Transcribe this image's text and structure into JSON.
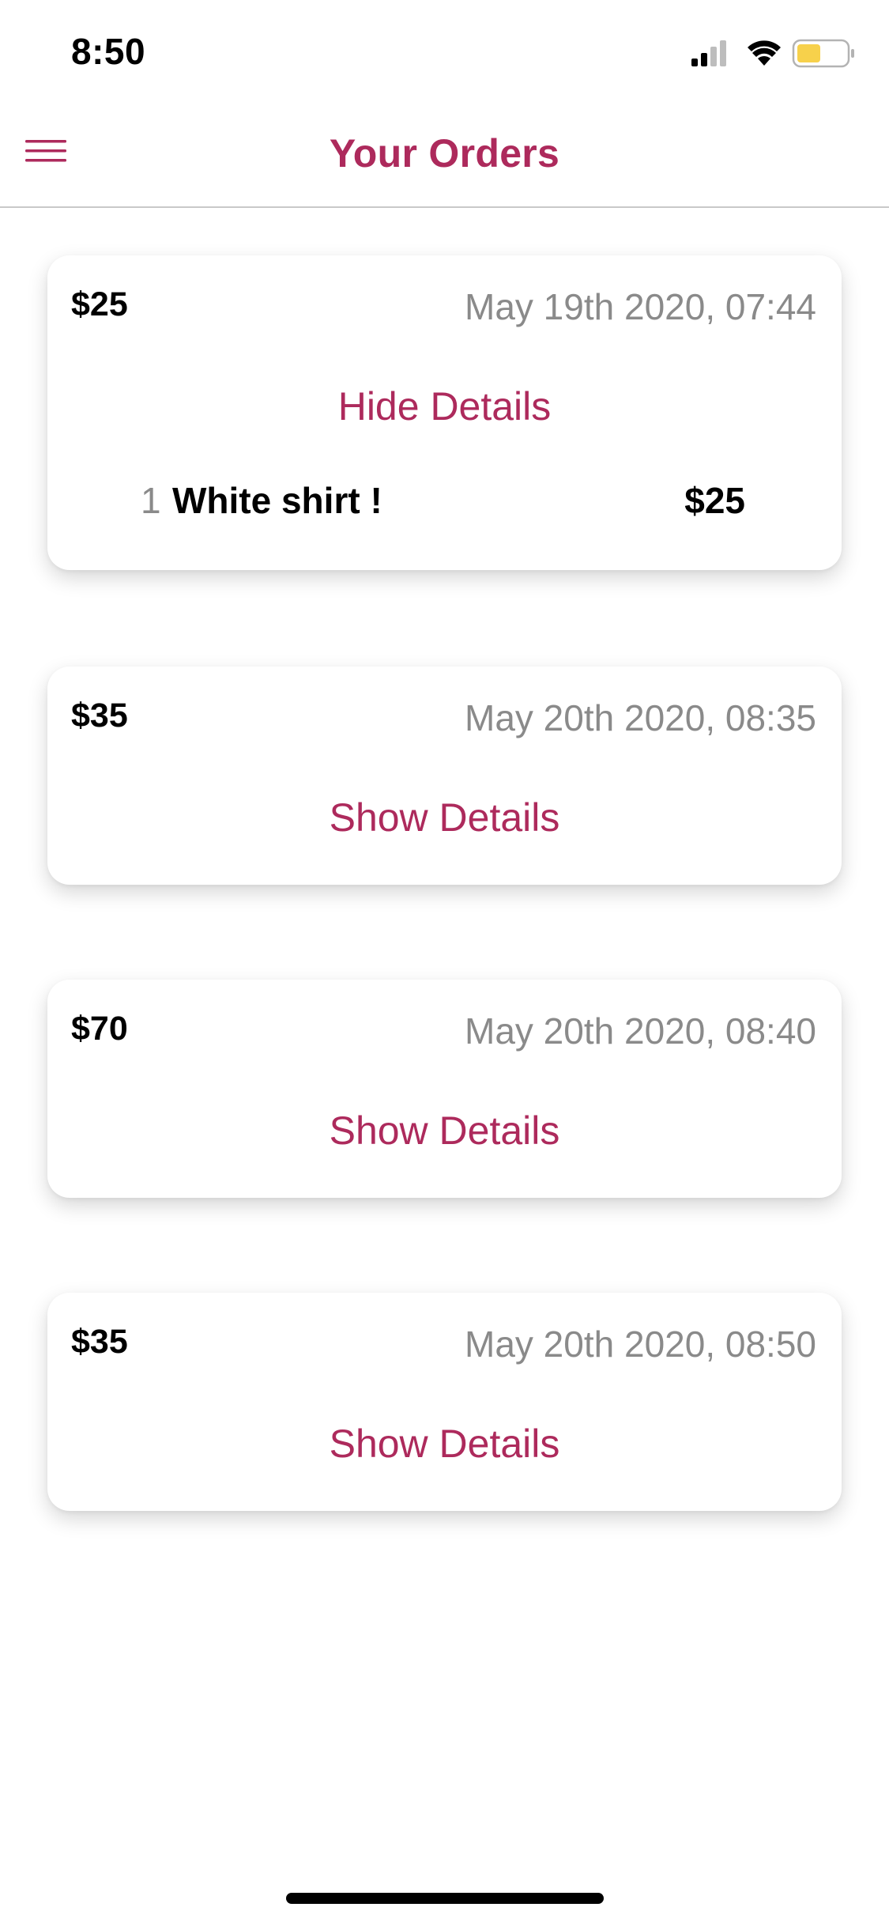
{
  "status_bar": {
    "time": "8:50",
    "icons": [
      "cellular-signal-icon",
      "wifi-icon",
      "battery-icon"
    ]
  },
  "header": {
    "title": "Your Orders",
    "menu_icon": "hamburger-menu-icon"
  },
  "colors": {
    "accent": "#ad2a5c",
    "muted_text": "#8a8a8a",
    "battery_fill": "#f7d14b"
  },
  "orders": [
    {
      "total": "$25",
      "date": "May 19th 2020, 07:44",
      "toggle_label": "Hide Details",
      "expanded": true,
      "items": [
        {
          "quantity": "1",
          "name": "White shirt !",
          "price": "$25"
        }
      ]
    },
    {
      "total": "$35",
      "date": "May 20th 2020, 08:35",
      "toggle_label": "Show Details",
      "expanded": false
    },
    {
      "total": "$70",
      "date": "May 20th 2020, 08:40",
      "toggle_label": "Show Details",
      "expanded": false
    },
    {
      "total": "$35",
      "date": "May 20th 2020, 08:50",
      "toggle_label": "Show Details",
      "expanded": false
    }
  ]
}
